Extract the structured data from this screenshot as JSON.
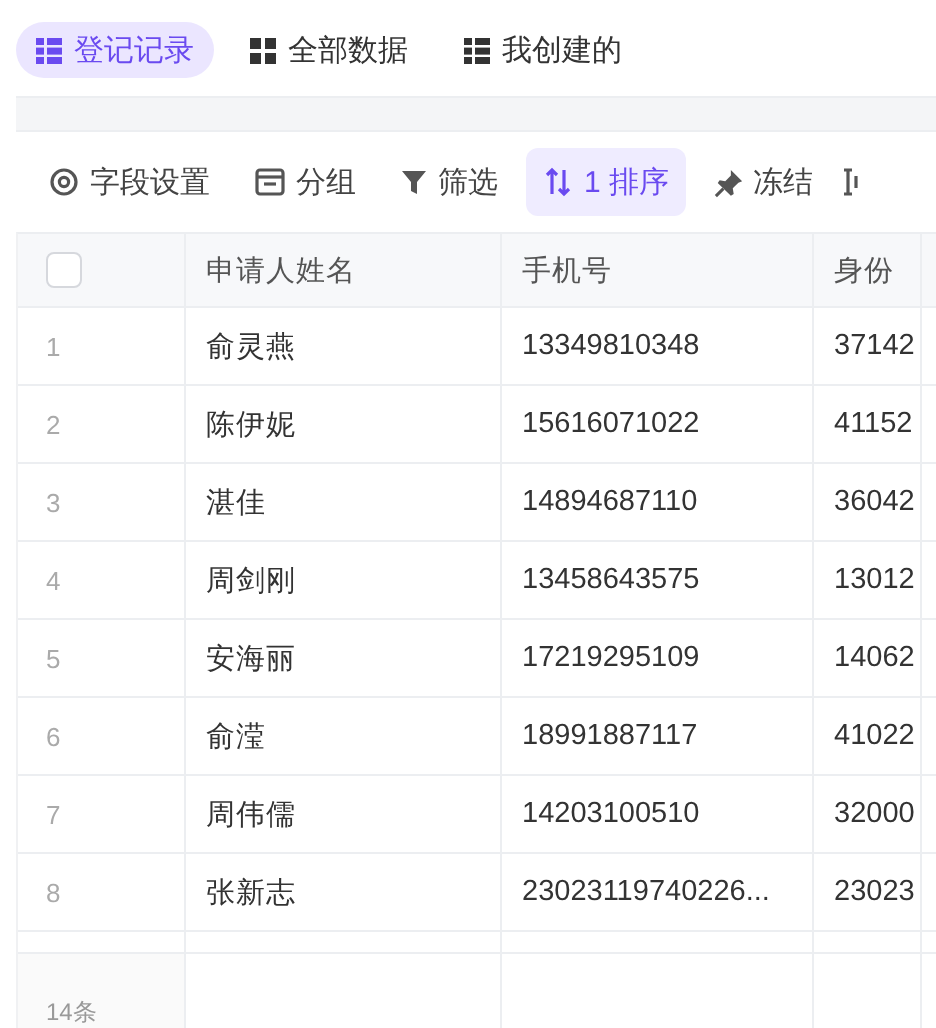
{
  "tabs": [
    {
      "label": "登记记录",
      "selected": true
    },
    {
      "label": "全部数据",
      "selected": false
    },
    {
      "label": "我创建的",
      "selected": false
    }
  ],
  "toolbar": [
    {
      "label": "字段设置",
      "selected": false
    },
    {
      "label": "分组",
      "selected": false
    },
    {
      "label": "筛选",
      "selected": false
    },
    {
      "label": "1 排序",
      "selected": true
    },
    {
      "label": "冻结",
      "selected": false
    }
  ],
  "table": {
    "select_all": {
      "checked": false
    },
    "columns": [
      "申请人姓名",
      "手机号",
      "身份"
    ],
    "rows": [
      {
        "number": "1",
        "name": "俞灵燕",
        "phone": "13349810348",
        "column_3": "37142"
      },
      {
        "number": "2",
        "name": "陈伊妮",
        "phone": "15616071022",
        "column_3": "41152"
      },
      {
        "number": "3",
        "name": "湛佳",
        "phone": "14894687110",
        "column_3": "36042"
      },
      {
        "number": "4",
        "name": "周剑刚",
        "phone": "13458643575",
        "column_3": "13012"
      },
      {
        "number": "5",
        "name": "安海丽",
        "phone": "17219295109",
        "column_3": "14062"
      },
      {
        "number": "6",
        "name": "俞滢",
        "phone": "18991887117",
        "column_3": "41022"
      },
      {
        "number": "7",
        "name": "周伟儒",
        "phone": "14203100510",
        "column_3": "32000"
      },
      {
        "number": "8",
        "name": "张新志",
        "phone": "23023119740226...",
        "column_3": "23023"
      }
    ],
    "footer": {
      "count": "14条"
    }
  }
}
